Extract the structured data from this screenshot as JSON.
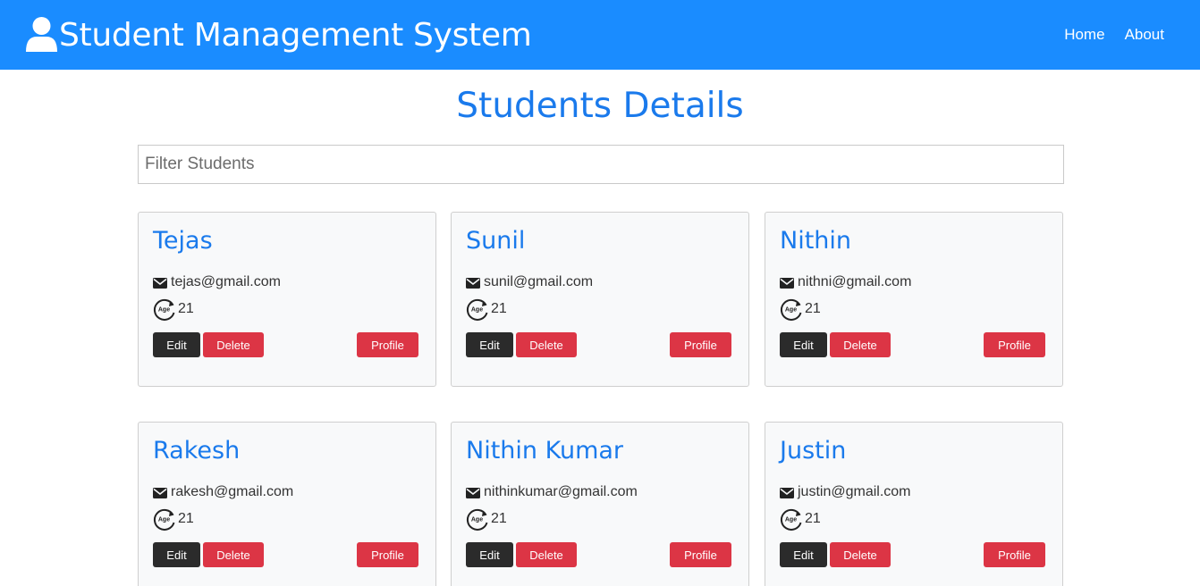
{
  "header": {
    "title": "Student Management System",
    "nav": [
      {
        "label": "Home"
      },
      {
        "label": "About"
      }
    ]
  },
  "page": {
    "title": "Students Details"
  },
  "filter": {
    "placeholder": "Filter Students",
    "value": ""
  },
  "students": [
    {
      "name": "Tejas",
      "email": "tejas@gmail.com",
      "age": "21"
    },
    {
      "name": "Sunil",
      "email": "sunil@gmail.com",
      "age": "21"
    },
    {
      "name": "Nithin",
      "email": "nithni@gmail.com",
      "age": "21"
    },
    {
      "name": "Rakesh",
      "email": "rakesh@gmail.com",
      "age": "21"
    },
    {
      "name": "Nithin Kumar",
      "email": "nithinkumar@gmail.com",
      "age": "21"
    },
    {
      "name": "Justin",
      "email": "justin@gmail.com",
      "age": "21"
    }
  ],
  "buttons": {
    "edit": "Edit",
    "delete": "Delete",
    "profile": "Profile"
  },
  "icons": {
    "brand": "user-icon",
    "email": "envelope-icon",
    "age": "age-icon"
  },
  "colors": {
    "navbar": "#1a8cff",
    "accent_text": "#1a7aec",
    "danger": "#dc3545",
    "dark": "#2b2b2b",
    "card_bg": "#f8f9fa"
  }
}
